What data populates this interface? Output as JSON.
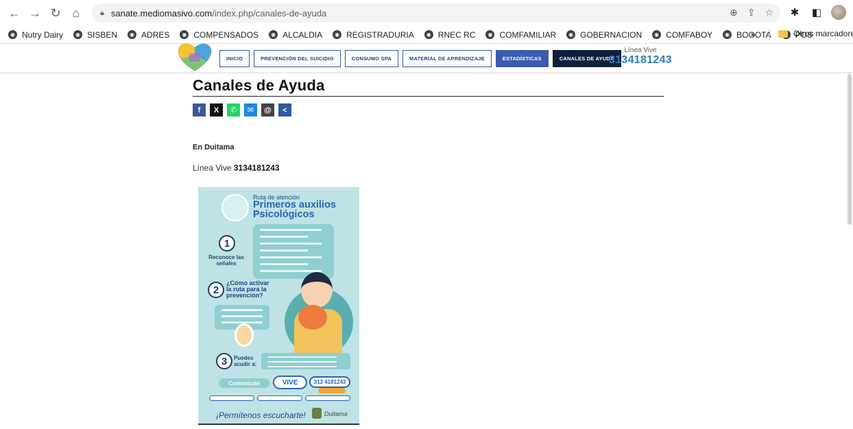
{
  "browser": {
    "url_host": "sanate.mediomasivo.com",
    "url_path": "/index.php/canales-de-ayuda",
    "nav_icons": [
      "back-icon",
      "forward-icon",
      "reload-icon",
      "home-icon"
    ],
    "omnibox_icons": [
      "zoom-icon",
      "share-icon",
      "star-icon"
    ],
    "right_icons": [
      "extensions-icon",
      "sidebar-icon",
      "profile-avatar",
      "menu-icon"
    ]
  },
  "bookmarks": {
    "items": [
      "Nutry Dairy",
      "SISBEN",
      "ADRES",
      "COMPENSADOS",
      "ALCALDIA",
      "REGISTRADURIA",
      "RNEC RC",
      "COMFAMILIAR",
      "GOBERNACION",
      "COMFABOY",
      "BOGOTA",
      "POS"
    ],
    "more": "»",
    "folder": "Otros marcadores"
  },
  "site": {
    "menu": [
      "INICIO",
      "PREVENCIÓN DEL SUICIDIO",
      "CONSUMO SPA",
      "MATERIAL DE APRENDIZAJE",
      "ESTADÍSTICAS",
      "CANALES DE AYUDA"
    ],
    "linea_label": "Línea Vive",
    "linea_number": "3134181243"
  },
  "content": {
    "title": "Canales de Ayuda",
    "share_icons": [
      "facebook-icon",
      "x-icon",
      "whatsapp-icon",
      "messenger-icon",
      "email-icon",
      "share-icon"
    ],
    "city": "En Duitama",
    "line_label": "Línea Vive",
    "line_number": "3134181243"
  },
  "poster": {
    "small": "Ruta de atención",
    "big1": "Primeros auxilios",
    "big2": "Psicológicos",
    "step1": "Reconoce las señales",
    "step2": "¿Cómo activar la ruta para la prevención?",
    "step3": "Puedes acudir a:",
    "comunicate": "Comunícate",
    "vive": "VIVE",
    "phone": "313 4181243",
    "bottom": "¡Permítenos escucharte!",
    "duitama": "Duitama"
  }
}
